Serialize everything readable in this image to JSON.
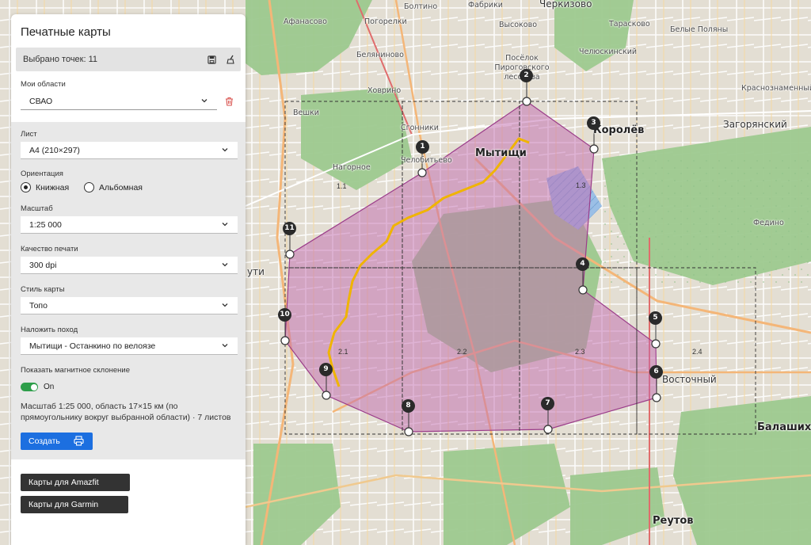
{
  "panel": {
    "title": "Печатные карты",
    "points_selected": "Выбрано точек: 11",
    "my_areas_label": "Мои области",
    "my_areas_value": "СВАО",
    "sheet_label": "Лист",
    "sheet_value": "A4 (210×297)",
    "orientation_label": "Ориентация",
    "orientation_portrait": "Книжная",
    "orientation_landscape": "Альбомная",
    "orientation_selected": "portrait",
    "scale_label": "Масштаб",
    "scale_value": "1:25 000",
    "quality_label": "Качество печати",
    "quality_value": "300 dpi",
    "style_label": "Стиль карты",
    "style_value": "Топо",
    "route_label": "Наложить поход",
    "route_value": "Мытищи - Останкино по велоязе",
    "declination_label": "Показать магнитное склонение",
    "declination_state": "On",
    "summary": "Масштаб 1:25 000, область 17×15 км (по прямоугольнику вокруг выбранной области) · 7 листов",
    "create_label": "Создать",
    "amazfit_label": "Карты для Amazfit",
    "garmin_label": "Карты для Garmin"
  },
  "icons": {
    "save": "save-icon",
    "clear": "broom-icon",
    "delete": "trash-icon",
    "print": "printer-icon",
    "chevron": "chevron-down-icon"
  },
  "colors": {
    "accent": "#1c6fe0",
    "toggle_on": "#2e9e4a",
    "area_fill": "#c26ab0",
    "area_stroke": "#9b3d8a",
    "route": "#f0b400",
    "trash": "#d9534f"
  },
  "map": {
    "places": {
      "afanasovo": "Афанасово",
      "boltino": "Болтино",
      "fabriki": "Фабрики",
      "cherkizovo": "Черкизово",
      "taraskovo": "Тарасково",
      "belye_polyany": "Белые Поляны",
      "chelyuskinsky": "Челюскинский",
      "goroelki": "Погорелки",
      "vysokovo": "Высоково",
      "belyaninovo": "Беляниново",
      "pirogovsky": "Посёлок Пироговского лесохоза",
      "khovrino": "Ховрино",
      "veshki": "Вешки",
      "sgonniki": "Сгонники",
      "chelobitevo": "Челобитьево",
      "nagornoe": "Нагорное",
      "mytishchi": "Мытищи",
      "korolev": "Королёв",
      "zagoryansky": "Загорянский",
      "krasnoznamenny": "Краснознаменный",
      "vostochny": "Восточный",
      "balashikha": "Балашиха",
      "reutov": "Реутов",
      "fedino": "Федино",
      "uti": "ути"
    },
    "cells": [
      "1.3",
      "2.1",
      "2.2",
      "2.3",
      "2.4",
      "1.1"
    ],
    "markers": [
      "1",
      "2",
      "3",
      "4",
      "5",
      "6",
      "7",
      "8",
      "9",
      "10",
      "11"
    ]
  }
}
